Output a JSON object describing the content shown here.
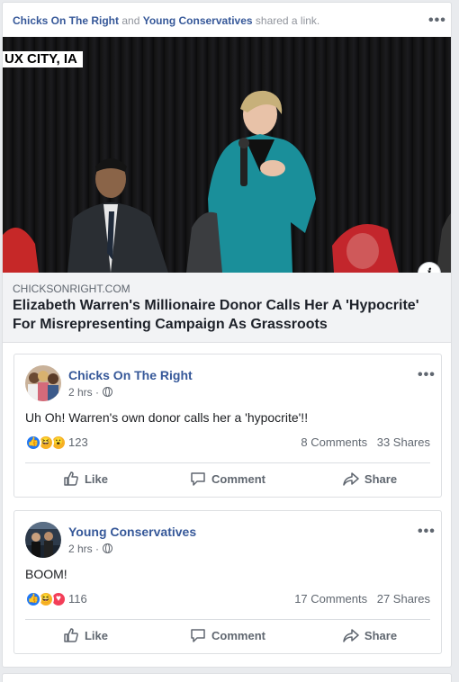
{
  "share_header": {
    "page1": "Chicks On The Right",
    "connector": "and",
    "page2": "Young Conservatives",
    "action": "shared a link."
  },
  "menu_icon": "more-horizontal-icon",
  "media": {
    "location_tag": "UX CITY, IA",
    "info_icon_label": "i"
  },
  "link_preview": {
    "domain": "CHICKSONRIGHT.COM",
    "headline": "Elizabeth Warren's Millionaire Donor Calls Her A 'Hypocrite' For Misrepresenting Campaign As Grassroots"
  },
  "posts": [
    {
      "author": "Chicks On The Right",
      "time": "2 hrs ·",
      "privacy_icon": "globe-icon",
      "text": "Uh Oh! Warren's own donor calls her a 'hypocrite'!!",
      "reaction_icons": [
        "like",
        "haha",
        "wow"
      ],
      "reaction_count": "123",
      "comments": "8 Comments",
      "shares": "33 Shares",
      "actions": {
        "like": "Like",
        "comment": "Comment",
        "share": "Share"
      }
    },
    {
      "author": "Young Conservatives",
      "time": "2 hrs ·",
      "privacy_icon": "globe-icon",
      "text": "BOOM!",
      "reaction_icons": [
        "like",
        "haha",
        "love"
      ],
      "reaction_count": "116",
      "comments": "17 Comments",
      "shares": "27 Shares",
      "actions": {
        "like": "Like",
        "comment": "Comment",
        "share": "Share"
      }
    }
  ],
  "colors": {
    "link_blue": "#365899",
    "background": "#e9ebee",
    "like_blue": "#2078f4",
    "love_red": "#f33e58",
    "haha_yellow": "#f7b125"
  }
}
